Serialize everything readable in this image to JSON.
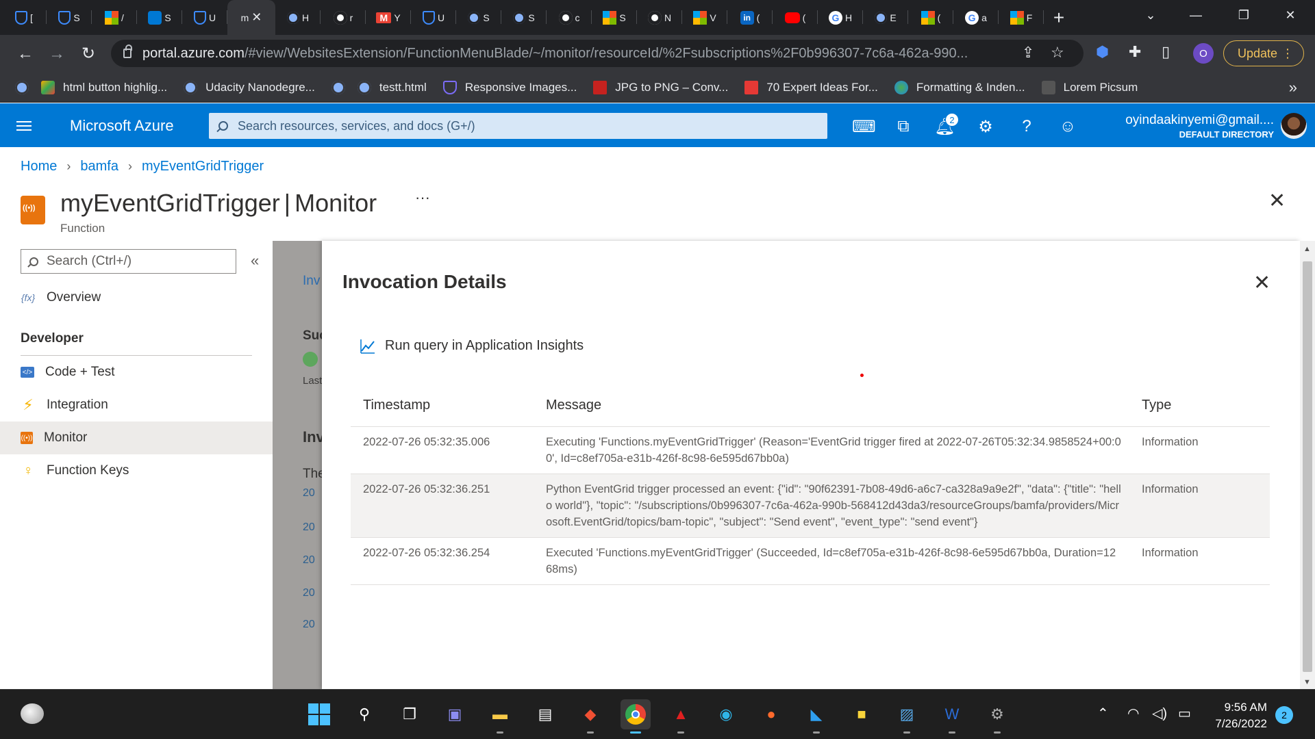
{
  "browser": {
    "tabs": [
      {
        "icon": "udacity-icon",
        "letter": "["
      },
      {
        "icon": "udacity-icon",
        "letter": "S"
      },
      {
        "icon": "microsoft-icon",
        "letter": "/"
      },
      {
        "icon": "azure-square-icon",
        "letter": "S"
      },
      {
        "icon": "udacity-icon",
        "letter": "U"
      },
      {
        "icon": "active-tab",
        "letter": "m",
        "active": true
      },
      {
        "icon": "globe-icon",
        "letter": "H"
      },
      {
        "icon": "github-icon",
        "letter": "r"
      },
      {
        "icon": "gmail-icon",
        "letter": "Y"
      },
      {
        "icon": "udacity-icon",
        "letter": "U"
      },
      {
        "icon": "globe-icon",
        "letter": "S"
      },
      {
        "icon": "globe-icon",
        "letter": "S"
      },
      {
        "icon": "github-icon",
        "letter": "c"
      },
      {
        "icon": "microsoft-icon",
        "letter": "S"
      },
      {
        "icon": "chatgpt-icon",
        "letter": "N"
      },
      {
        "icon": "microsoft-icon",
        "letter": "V"
      },
      {
        "icon": "linkedin-icon",
        "letter": "("
      },
      {
        "icon": "youtube-icon",
        "letter": "("
      },
      {
        "icon": "google-icon",
        "letter": "H"
      },
      {
        "icon": "globe-icon",
        "letter": "E"
      },
      {
        "icon": "microsoft-icon",
        "letter": "("
      },
      {
        "icon": "google-icon",
        "letter": "a"
      },
      {
        "icon": "microsoft-icon",
        "letter": "F"
      }
    ],
    "address": {
      "domain": "portal.azure.com",
      "path": "/#view/WebsitesExtension/FunctionMenuBlade/~/monitor/resourceId/%2Fsubscriptions%2F0b996307-7c6a-462a-990..."
    },
    "profile_initial": "O",
    "update_label": "Update",
    "bookmarks": [
      {
        "icon": "globe-icon",
        "label": ""
      },
      {
        "icon": "extension-icon",
        "label": "html button highlig..."
      },
      {
        "icon": "globe-icon",
        "label": "Udacity Nanodegre..."
      },
      {
        "icon": "globe-icon",
        "label": ""
      },
      {
        "icon": "globe-icon",
        "label": "testt.html"
      },
      {
        "icon": "udacity-icon",
        "label": "Responsive Images..."
      },
      {
        "icon": "jpg-png-icon",
        "label": "JPG to PNG – Conv..."
      },
      {
        "icon": "s-icon",
        "label": "70 Expert Ideas For..."
      },
      {
        "icon": "earth-icon",
        "label": "Formatting & Inden..."
      },
      {
        "icon": "picsum-icon",
        "label": "Lorem Picsum"
      }
    ]
  },
  "azure": {
    "brand": "Microsoft Azure",
    "search_placeholder": "Search resources, services, and docs (G+/)",
    "notification_count": "2",
    "account_email": "oyindaakinyemi@gmail....",
    "account_directory": "DEFAULT DIRECTORY"
  },
  "breadcrumb": [
    "Home",
    "bamfa",
    "myEventGridTrigger"
  ],
  "page": {
    "title": "myEventGridTrigger",
    "section": "Monitor",
    "kind": "Function",
    "more": "···"
  },
  "menu": {
    "search_placeholder": "Search (Ctrl+/)",
    "collapse": "«",
    "overview": "Overview",
    "group": "Developer",
    "items": [
      {
        "label": "Code + Test",
        "icon": "code-icon"
      },
      {
        "label": "Integration",
        "icon": "lightning-icon"
      },
      {
        "label": "Monitor",
        "icon": "monitor-icon",
        "selected": true
      },
      {
        "label": "Function Keys",
        "icon": "key-icon"
      }
    ]
  },
  "background_peek": [
    "Inv",
    "Suc",
    "Last",
    "Inv",
    "The",
    "20",
    "20",
    "20",
    "20",
    "20"
  ],
  "panel": {
    "title": "Invocation Details",
    "run_query": "Run query in Application Insights",
    "columns": [
      "Timestamp",
      "Message",
      "Type"
    ],
    "rows": [
      {
        "timestamp": "2022-07-26 05:32:35.006",
        "message": "Executing 'Functions.myEventGridTrigger' (Reason='EventGrid trigger fired at 2022-07-26T05:32:34.9858524+00:00', Id=c8ef705a-e31b-426f-8c98-6e595d67bb0a)",
        "type": "Information"
      },
      {
        "timestamp": "2022-07-26 05:32:36.251",
        "message": "Python EventGrid trigger processed an event: {\"id\": \"90f62391-7b08-49d6-a6c7-ca328a9a9e2f\", \"data\": {\"title\": \"hello world\"}, \"topic\": \"/subscriptions/0b996307-7c6a-462a-990b-568412d43da3/resourceGroups/bamfa/providers/Microsoft.EventGrid/topics/bam-topic\", \"subject\": \"Send event\", \"event_type\": \"send event\"}",
        "type": "Information"
      },
      {
        "timestamp": "2022-07-26 05:32:36.254",
        "message": "Executed 'Functions.myEventGridTrigger' (Succeeded, Id=c8ef705a-e31b-426f-8c98-6e595d67bb0a, Duration=1268ms)",
        "type": "Information"
      }
    ]
  },
  "taskbar": {
    "time": "9:56 AM",
    "date": "7/26/2022",
    "notification_count": "2"
  },
  "colors": {
    "azure_blue": "#0078d4",
    "chrome_dark": "#202124",
    "update_gold": "#f0c25c"
  }
}
